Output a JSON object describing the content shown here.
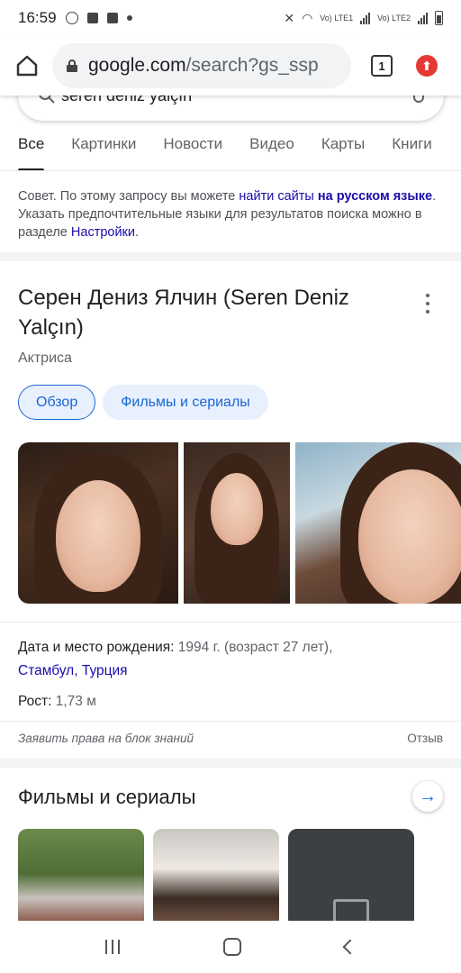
{
  "status_bar": {
    "time": "16:59",
    "indicators": [
      "b-icon",
      "message-icon",
      "image-icon",
      "dot-icon"
    ],
    "right_icons": [
      "mute-icon",
      "wifi-icon",
      "signal-lte1-icon",
      "signal-lte2-icon",
      "battery-icon"
    ],
    "lte1": "Vo) LTE1",
    "lte2": "Vo) LTE2"
  },
  "browser": {
    "url_host": "google.com",
    "url_path": "/search?gs_ssp",
    "tab_count": "1"
  },
  "search": {
    "query": "seren deniz yalçın"
  },
  "tabs": [
    {
      "label": "Все",
      "active": true
    },
    {
      "label": "Картинки",
      "active": false
    },
    {
      "label": "Новости",
      "active": false
    },
    {
      "label": "Видео",
      "active": false
    },
    {
      "label": "Карты",
      "active": false
    },
    {
      "label": "Книги",
      "active": false
    }
  ],
  "tip": {
    "prefix": "Совет. По этому запросу вы можете ",
    "link1": "найти сайты",
    "middle1": " ",
    "link2": "на русском языке",
    "middle2": ". Указать предпочтительные языки для результатов поиска можно в разделе ",
    "link3": "Настройки",
    "suffix": "."
  },
  "knowledge_panel": {
    "title": "Серен Дениз Ялчин (Seren Deniz Yalçın)",
    "subtitle": "Актриса",
    "chips": [
      {
        "label": "Обзор",
        "active": true
      },
      {
        "label": "Фильмы и сериалы",
        "active": false
      }
    ],
    "birth_label": "Дата и место рождения: ",
    "birth_value": "1994 г. (возраст 27 лет),",
    "birth_city": "Стамбул",
    "birth_sep": ", ",
    "birth_country": "Турция",
    "height_label": "Рост: ",
    "height_value": "1,73 м",
    "claim": "Заявить права на блок знаний",
    "feedback": "Отзыв"
  },
  "films": {
    "title": "Фильмы и сериалы"
  }
}
